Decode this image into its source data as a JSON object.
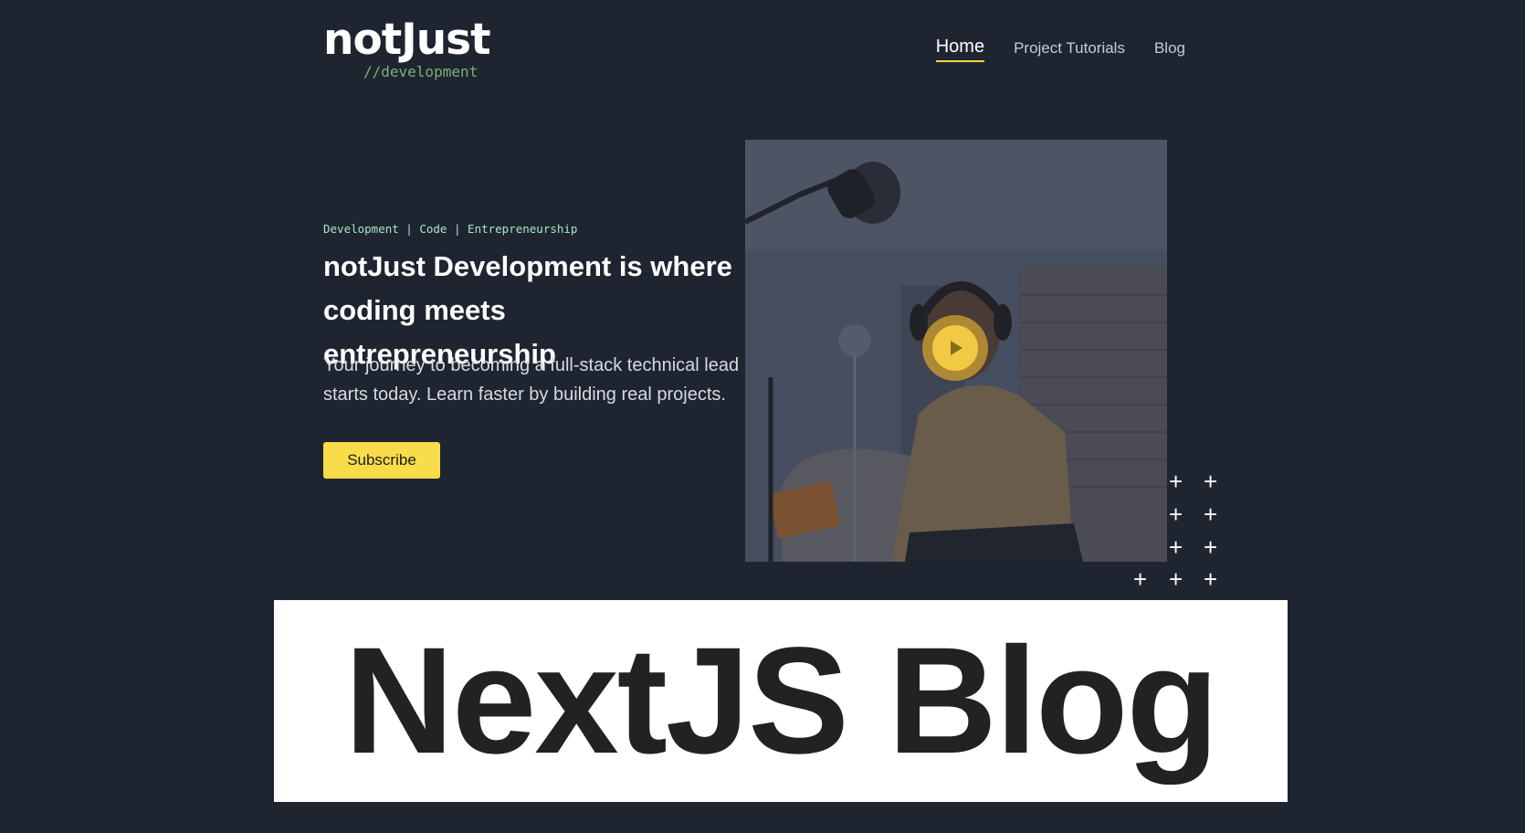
{
  "header": {
    "logo": {
      "name": "notJust",
      "sub": "//development"
    },
    "nav": [
      {
        "label": "Home",
        "active": true
      },
      {
        "label": "Project Tutorials",
        "active": false
      },
      {
        "label": "Blog",
        "active": false
      }
    ]
  },
  "hero": {
    "tagline": "Development | Code | Entrepreneurship",
    "headline": "notJust Development is where coding meets entrepreneurship",
    "intro": "Your journey to becoming a full-stack technical lead starts today. Learn faster by building real projects.",
    "subscribe_label": "Subscribe"
  },
  "video": {
    "play_icon": "play-icon"
  },
  "banner": {
    "title": "NextJS Blog"
  },
  "colors": {
    "background": "#1f2530",
    "accent": "#f8dc4a",
    "tagline": "#a8e6c8",
    "logo_sub": "#7ab07a"
  }
}
